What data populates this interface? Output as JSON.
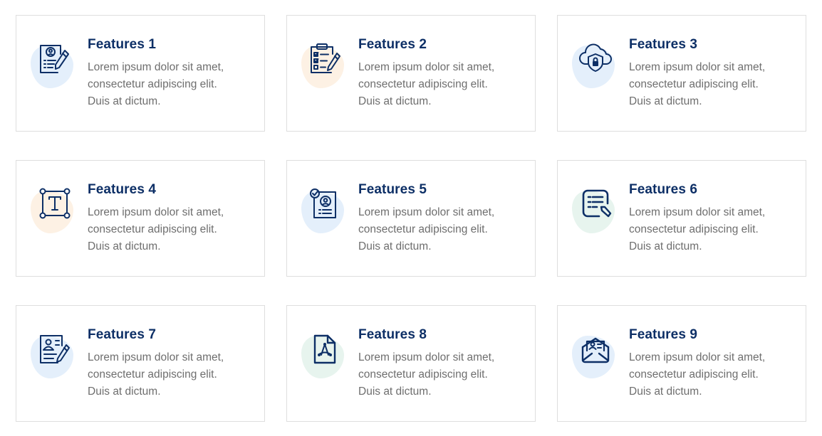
{
  "colors": {
    "title": "#0d2f66",
    "text": "#6e6e6e",
    "border": "#dedede",
    "blob_blue": "#e4effb",
    "blob_orange": "#fdf1e4",
    "blob_green": "#e7f4ee"
  },
  "features": [
    {
      "title": "Features 1",
      "line1": "Lorem ipsum dolor sit amet,",
      "line2": "consectetur adipiscing elit.",
      "line3": "Duis at dictum.",
      "icon": "resume-pen-icon",
      "blob": "#e4effb"
    },
    {
      "title": "Features 2",
      "line1": "Lorem ipsum dolor sit amet,",
      "line2": "consectetur adipiscing elit.",
      "line3": "Duis at dictum.",
      "icon": "clipboard-checklist-icon",
      "blob": "#fdf1e4"
    },
    {
      "title": "Features 3",
      "line1": "Lorem ipsum dolor sit amet,",
      "line2": "consectetur adipiscing elit.",
      "line3": "Duis at dictum.",
      "icon": "cloud-security-icon",
      "blob": "#e4effb"
    },
    {
      "title": "Features 4",
      "line1": "Lorem ipsum dolor sit amet,",
      "line2": "consectetur adipiscing elit.",
      "line3": "Duis at dictum.",
      "icon": "text-box-icon",
      "blob": "#fdf1e4"
    },
    {
      "title": "Features 5",
      "line1": "Lorem ipsum dolor sit amet,",
      "line2": "consectetur adipiscing elit.",
      "line3": "Duis at dictum.",
      "icon": "verified-profile-icon",
      "blob": "#e4effb"
    },
    {
      "title": "Features 6",
      "line1": "Lorem ipsum dolor sit amet,",
      "line2": "consectetur adipiscing elit.",
      "line3": "Duis at dictum.",
      "icon": "edit-document-icon",
      "blob": "#e7f4ee"
    },
    {
      "title": "Features 7",
      "line1": "Lorem ipsum dolor sit amet,",
      "line2": "consectetur adipiscing elit.",
      "line3": "Duis at dictum.",
      "icon": "contact-card-pen-icon",
      "blob": "#e4effb"
    },
    {
      "title": "Features 8",
      "line1": "Lorem ipsum dolor sit amet,",
      "line2": "consectetur adipiscing elit.",
      "line3": "Duis at dictum.",
      "icon": "pdf-file-icon",
      "blob": "#e7f4ee"
    },
    {
      "title": "Features 9",
      "line1": "Lorem ipsum dolor sit amet,",
      "line2": "consectetur adipiscing elit.",
      "line3": "Duis at dictum.",
      "icon": "contact-envelope-icon",
      "blob": "#e4effb"
    }
  ]
}
